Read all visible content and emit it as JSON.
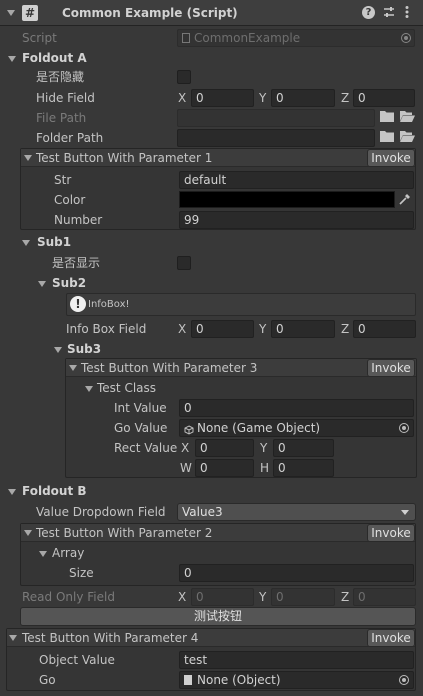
{
  "header": {
    "title": "Common Example (Script)",
    "help_icon": "help-icon",
    "settings_icon": "settings-icon",
    "menu_icon": "kebab-menu-icon"
  },
  "script": {
    "label": "Script",
    "value": "CommonExample"
  },
  "foldout_a": {
    "title": "Foldout A",
    "hide_toggle_label": "是否隐藏",
    "hide_field_label": "Hide Field",
    "hide_field": {
      "x": "0",
      "y": "0",
      "z": "0"
    },
    "file_path_label": "File Path",
    "folder_path_label": "Folder Path"
  },
  "axis": {
    "x": "X",
    "y": "Y",
    "z": "Z",
    "w": "W",
    "h": "H"
  },
  "method1": {
    "title": "Test Button With Parameter 1",
    "invoke": "Invoke",
    "str_label": "Str",
    "str_value": "default",
    "color_label": "Color",
    "color_value": "#000000",
    "number_label": "Number",
    "number_value": "99"
  },
  "sub1": {
    "title": "Sub1",
    "show_toggle_label": "是否显示",
    "sub2": {
      "title": "Sub2",
      "infobox_text": "InfoBox!",
      "infobox_field_label": "Info Box Field",
      "infobox_field": {
        "x": "0",
        "y": "0",
        "z": "0"
      },
      "sub3": {
        "title": "Sub3",
        "method3": {
          "title": "Test Button With Parameter 3",
          "invoke": "Invoke",
          "class_title": "Test Class",
          "int_label": "Int Value",
          "int_value": "0",
          "go_label": "Go Value",
          "go_value": "None (Game Object)",
          "rect_label": "Rect Value",
          "rect": {
            "x": "0",
            "y": "0",
            "w": "0",
            "h": "0"
          }
        }
      }
    }
  },
  "foldout_b": {
    "title": "Foldout B",
    "dropdown_label": "Value Dropdown Field",
    "dropdown_value": "Value3",
    "method2": {
      "title": "Test Button With Parameter 2",
      "invoke": "Invoke",
      "array_title": "Array",
      "size_label": "Size",
      "size_value": "0"
    },
    "readonly_label": "Read Only Field",
    "readonly": {
      "x": "0",
      "y": "0",
      "z": "0"
    },
    "test_button": "测试按钮"
  },
  "method4": {
    "title": "Test Button With Parameter 4",
    "invoke": "Invoke",
    "object_label": "Object Value",
    "object_value": "test",
    "go_label": "Go",
    "go_value": "None (Object)"
  }
}
